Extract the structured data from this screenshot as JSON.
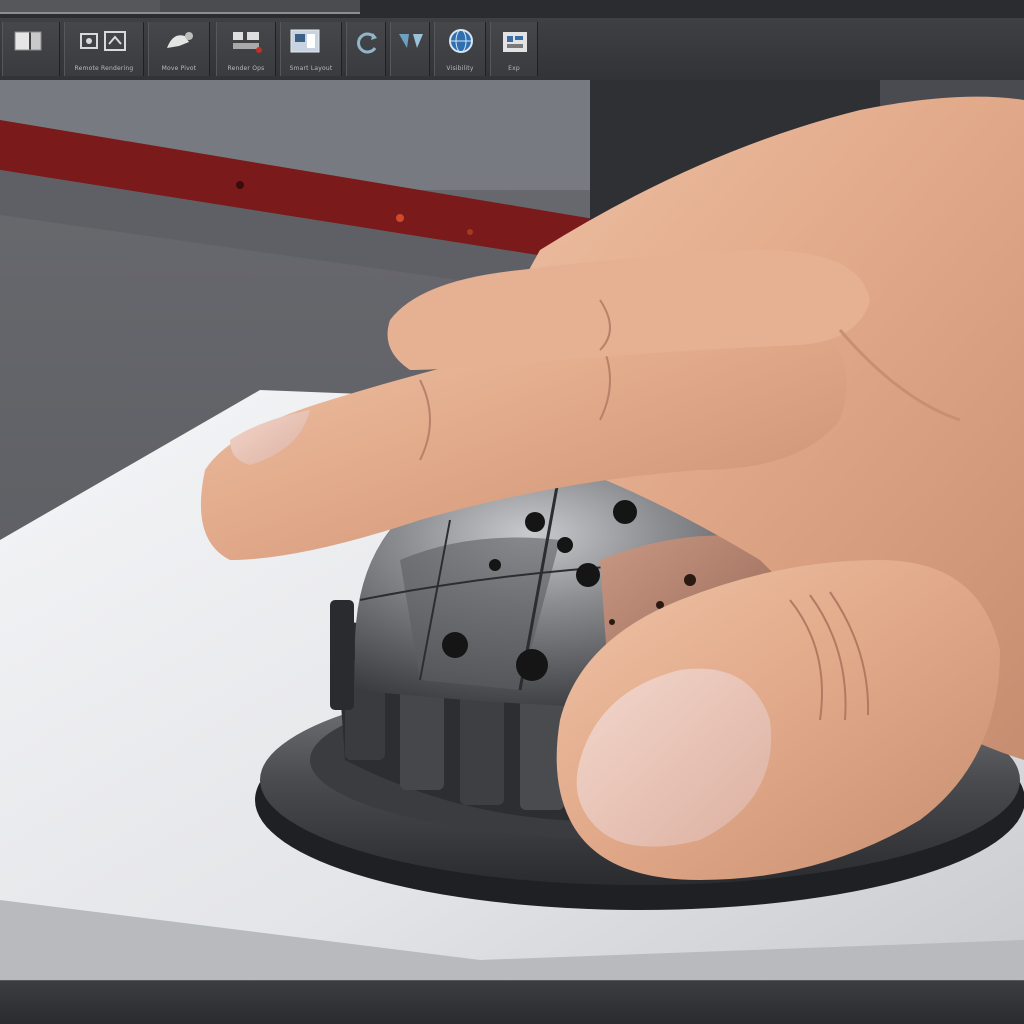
{
  "toolbar": {
    "groups": [
      {
        "label": "",
        "icon": "panel-toggle-icon"
      },
      {
        "label": "Remote Rendering",
        "icon": "render-settings-icon"
      },
      {
        "label": "Move Pivot",
        "icon": "pivot-tool-icon"
      },
      {
        "label": "Render Ops",
        "icon": "render-ops-icon"
      },
      {
        "label": "Smart Layout",
        "icon": "layout-icon"
      },
      {
        "label": "",
        "icon": "refresh-icon"
      },
      {
        "label": "",
        "icon": "split-icon"
      },
      {
        "label": "Visibility",
        "icon": "globe-icon"
      },
      {
        "label": "Exp",
        "icon": "export-icon"
      }
    ]
  },
  "colors": {
    "toolbar_bg": "#3a3b3f",
    "accent_red": "#7a1a1a",
    "skin": "#e0a888",
    "metal": "#6e6f73",
    "paper": "#e9eaec"
  },
  "viewport": {
    "subject": "hand-pressing-metal-dome-knob"
  }
}
